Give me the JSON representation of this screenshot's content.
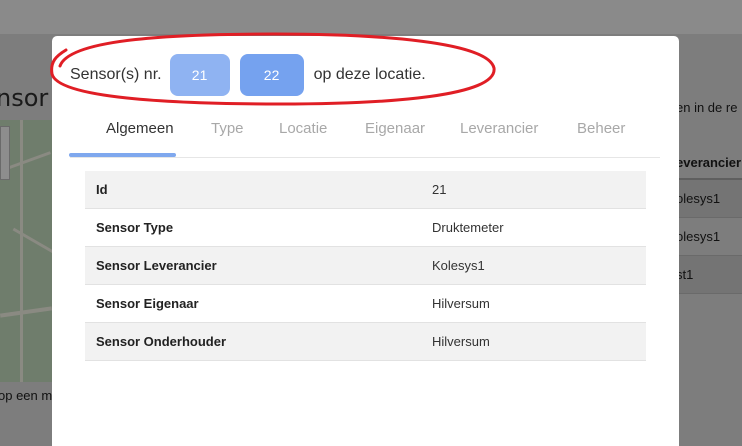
{
  "background": {
    "page_title": "nsor",
    "right_hint": "en in de re",
    "table_header": "everancier",
    "table_rows": [
      "olesys1",
      "olesys1",
      "st1"
    ],
    "footer_text": "op een m"
  },
  "modal": {
    "header": {
      "prefix": "Sensor(s) nr.",
      "sensors": [
        "21",
        "22"
      ],
      "suffix": "op deze locatie."
    },
    "tabs": [
      {
        "label": "Algemeen",
        "active": true
      },
      {
        "label": "Type",
        "active": false
      },
      {
        "label": "Locatie",
        "active": false
      },
      {
        "label": "Eigenaar",
        "active": false
      },
      {
        "label": "Leverancier",
        "active": false
      },
      {
        "label": "Beheer",
        "active": false
      }
    ],
    "details": [
      {
        "key": "Id",
        "value": "21"
      },
      {
        "key": "Sensor Type",
        "value": "Druktemeter"
      },
      {
        "key": "Sensor Leverancier",
        "value": "Kolesys1"
      },
      {
        "key": "Sensor Eigenaar",
        "value": "Hilversum"
      },
      {
        "key": "Sensor Onderhouder",
        "value": "Hilversum"
      }
    ]
  },
  "colors": {
    "annotation": "#e01e25",
    "chip_light": "#8fb3f2",
    "chip_dark": "#75a2ef",
    "tab_indicator": "#7fa8ee"
  }
}
